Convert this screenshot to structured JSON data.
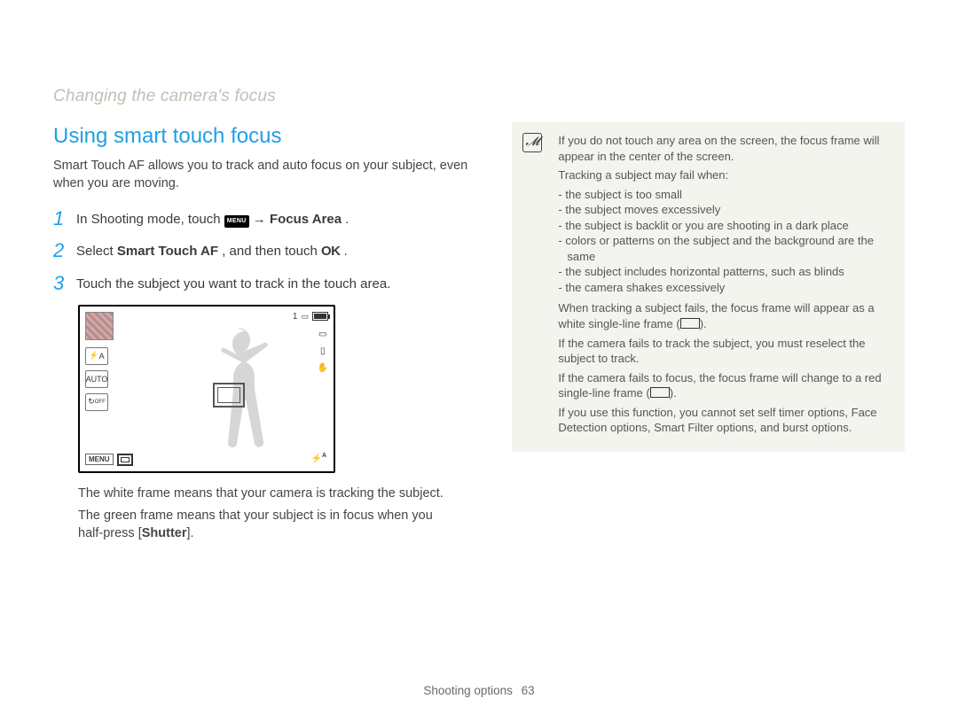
{
  "breadcrumb": "Changing the camera's focus",
  "section_title": "Using smart touch focus",
  "intro": "Smart Touch AF allows you to track and auto focus on your subject, even when you are moving.",
  "steps": {
    "s1_pre": "In Shooting mode, touch ",
    "s1_menu": "MENU",
    "s1_mid": " → ",
    "s1_bold": "Focus Area",
    "s1_post": ".",
    "s2_pre": "Select ",
    "s2_bold": "Smart Touch AF",
    "s2_mid": ", and then touch ",
    "s2_ok": "OK",
    "s2_post": ".",
    "s3": "Touch the subject you want to track in the touch area."
  },
  "camera_preview": {
    "counter": "1",
    "menu_label": "MENU",
    "flash_label": "A",
    "hand_label": "✋",
    "landscape_label": "▭",
    "off_icon_label": "↻",
    "auto_label": "AUTO"
  },
  "after_fig": {
    "p1": "The white frame means that your camera is tracking the subject.",
    "p2_pre": "The green frame means that your subject is in focus when you half-press [",
    "p2_bold": "Shutter",
    "p2_post": "]."
  },
  "note": {
    "p1": "If you do not touch any area on the screen, the focus frame will appear in the center of the screen.",
    "tracking_intro": "Tracking a subject may fail when:",
    "bullets": [
      "the subject is too small",
      "the subject moves excessively",
      "the subject is backlit or you are shooting in a dark place",
      "colors or patterns on the subject and the background are the same",
      "the subject includes horizontal patterns, such as blinds",
      "the camera shakes excessively"
    ],
    "p2_pre": "When tracking a subject fails, the focus frame will appear as a white single-line frame (",
    "p2_post": ").",
    "p3": "If the camera fails to track the subject, you must reselect the subject to track.",
    "p4_pre": "If the camera fails to focus, the focus frame will change to a red single-line frame (",
    "p4_post": ").",
    "p5": "If you use this function, you cannot set self timer options, Face Detection options, Smart Filter options, and burst options."
  },
  "footer": {
    "section": "Shooting options",
    "page": "63"
  }
}
